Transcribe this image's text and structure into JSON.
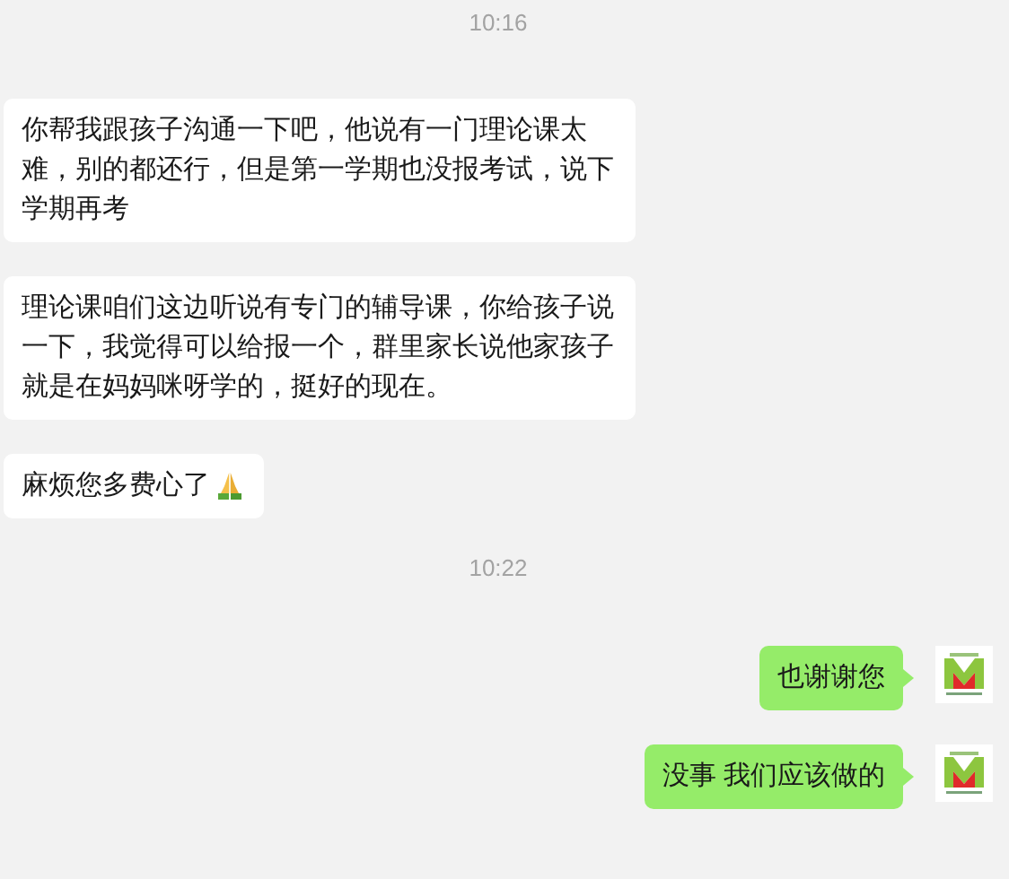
{
  "chat": [
    {
      "kind": "time",
      "text": "10:16"
    },
    {
      "kind": "received",
      "text": "你帮我跟孩子沟通一下吧，他说有一门理论课太难，别的都还行，但是第一学期也没报考试，说下学期再考"
    },
    {
      "kind": "received",
      "text": "理论课咱们这边听说有专门的辅导课，你给孩子说一下，我觉得可以给报一个，群里家长说他家孩子就是在妈妈咪呀学的，挺好的现在。"
    },
    {
      "kind": "received_emoji",
      "text": "麻烦您多费心了"
    },
    {
      "kind": "time",
      "text": "10:22"
    },
    {
      "kind": "sent",
      "text": "也谢谢您"
    },
    {
      "kind": "sent",
      "text": "没事 我们应该做的"
    }
  ]
}
